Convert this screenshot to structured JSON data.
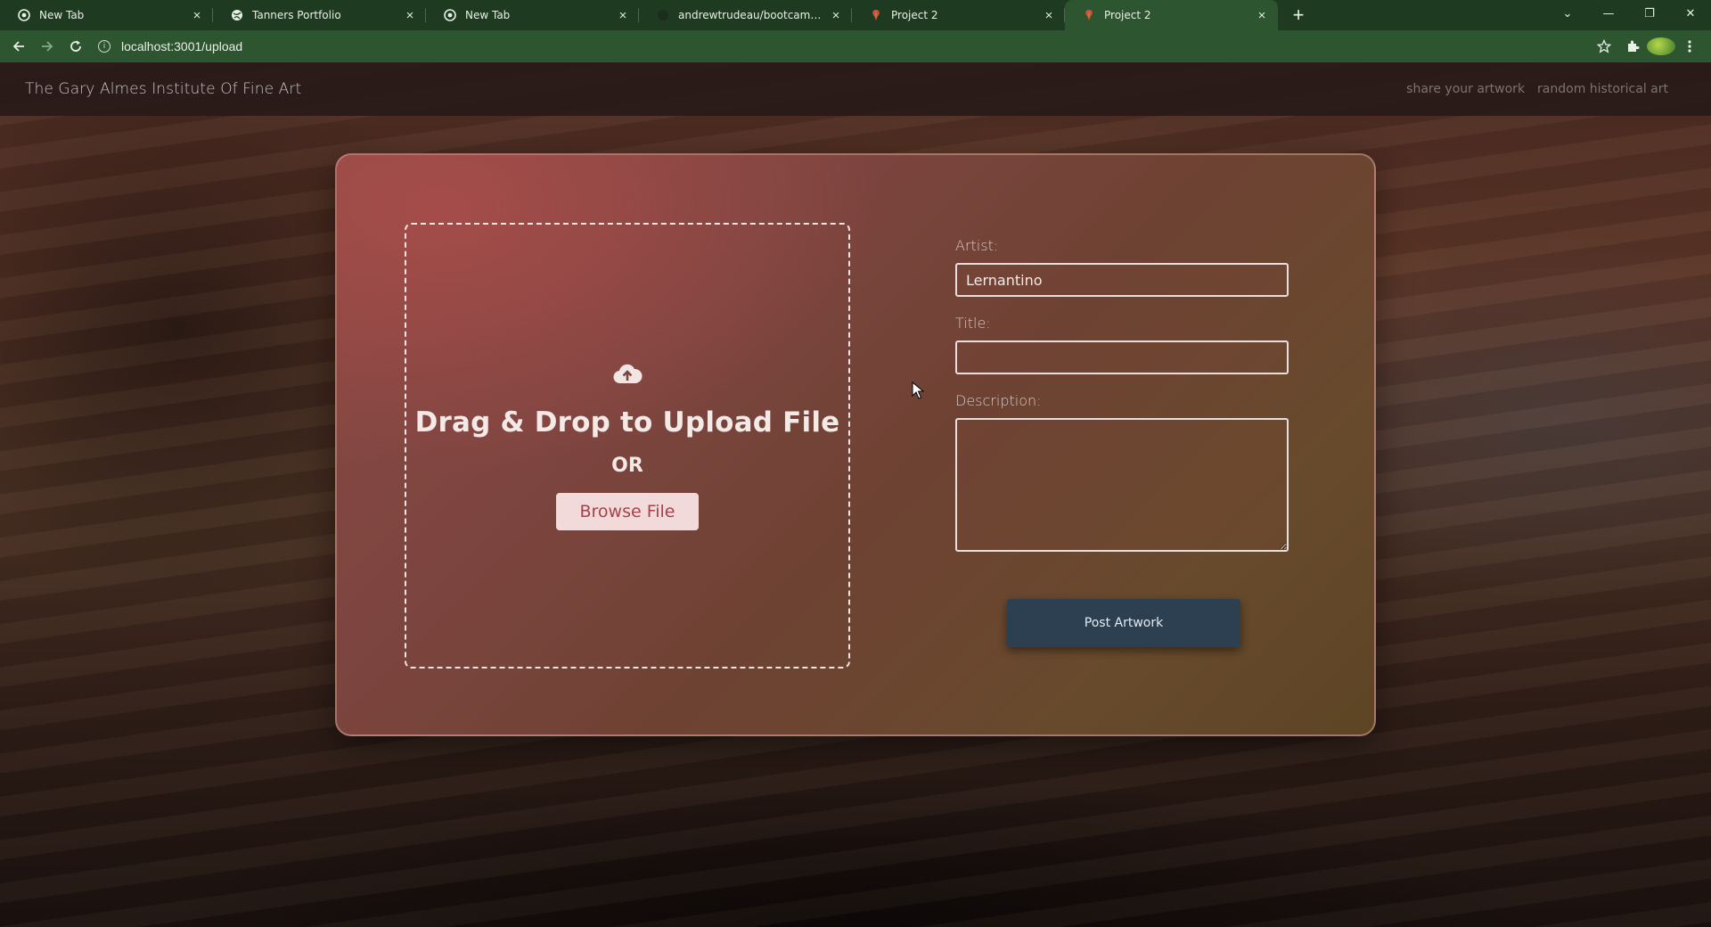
{
  "browser": {
    "tabs": [
      {
        "title": "New Tab",
        "favicon": "chrome-icon",
        "active": false
      },
      {
        "title": "Tanners Portfolio",
        "favicon": "globe-icon",
        "active": false
      },
      {
        "title": "New Tab",
        "favicon": "chrome-icon",
        "active": false
      },
      {
        "title": "andrewtrudeau/bootcamp-proje",
        "favicon": "github-icon",
        "active": false
      },
      {
        "title": "Project 2",
        "favicon": "rose-icon",
        "active": false
      },
      {
        "title": "Project 2",
        "favicon": "rose-icon",
        "active": true
      }
    ],
    "url": "localhost:3001/upload"
  },
  "site": {
    "brand": "The Gary Almes Institute Of Fine Art",
    "nav": [
      "share your artwork",
      "random historical art"
    ]
  },
  "upload": {
    "title": "Drag & Drop to Upload File",
    "or": "OR",
    "browse_label": "Browse File",
    "icon": "cloud-upload-icon"
  },
  "form": {
    "artist_label": "Artist:",
    "artist_value": "Lernantino",
    "title_label": "Title:",
    "title_value": "",
    "description_label": "Description:",
    "description_value": "",
    "submit_label": "Post Artwork"
  }
}
